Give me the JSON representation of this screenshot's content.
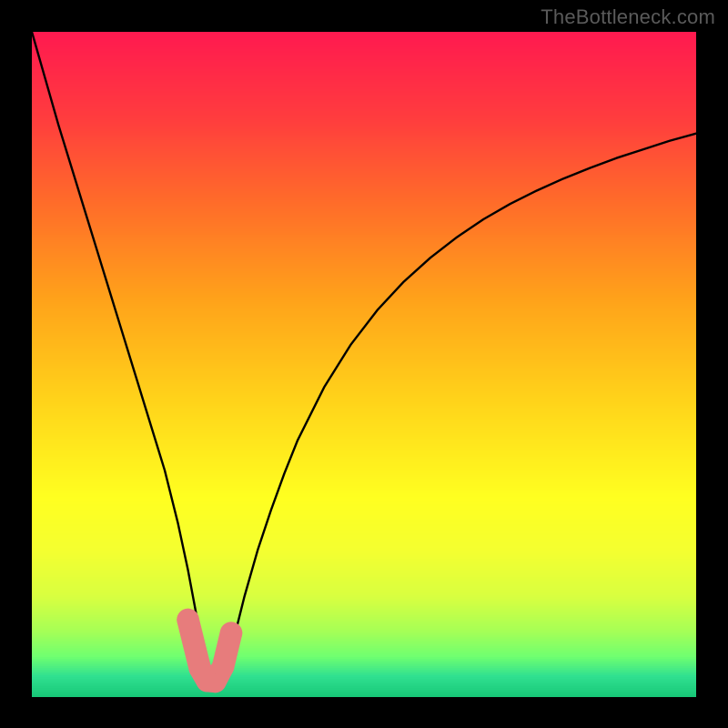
{
  "watermark": "TheBottleneck.com",
  "chart_data": {
    "type": "line",
    "title": "",
    "xlabel": "",
    "ylabel": "",
    "xlim": [
      0,
      100
    ],
    "ylim": [
      0,
      100
    ],
    "grid": false,
    "legend": false,
    "note": "Bottleneck-percentage style curve. Values in percent (0-100). X is normalized horizontal position (0=left,100=right), Y is percent height from bottom (0=green/low,100=red/high). Minimum near x≈27.",
    "series": [
      {
        "name": "bottleneck",
        "x": [
          0,
          2,
          4,
          6,
          8,
          10,
          12,
          14,
          16,
          18,
          20,
          22,
          23.5,
          25,
          26,
          27,
          28,
          29,
          30.5,
          32,
          34,
          36,
          38,
          40,
          44,
          48,
          52,
          56,
          60,
          64,
          68,
          72,
          76,
          80,
          84,
          88,
          92,
          96,
          100
        ],
        "y": [
          100,
          93,
          86,
          79.5,
          73,
          66.5,
          60,
          53.5,
          47,
          40.5,
          34,
          26,
          19,
          11,
          6,
          2.3,
          2,
          4,
          9,
          15,
          22,
          28,
          33.5,
          38.5,
          46.5,
          52.9,
          58.1,
          62.4,
          66,
          69.1,
          71.8,
          74.1,
          76.1,
          77.9,
          79.5,
          81,
          82.3,
          83.6,
          84.7
        ]
      }
    ],
    "markers": {
      "note": "Salmon dots/arc near the minimum dip",
      "color": "#e77c7c",
      "points_xy": [
        [
          23.5,
          11.5
        ],
        [
          25.3,
          4.2
        ],
        [
          26.4,
          2.3
        ],
        [
          27.6,
          2.2
        ],
        [
          28.8,
          4.5
        ],
        [
          30.0,
          9.5
        ]
      ],
      "radius": 1.6
    },
    "gradient": {
      "note": "Background heat gradient, top→bottom. 'pos' in percent from top; colors approximate.",
      "stops": [
        {
          "pos": 0,
          "color": "#ff1a4f"
        },
        {
          "pos": 12,
          "color": "#ff3a3f"
        },
        {
          "pos": 25,
          "color": "#ff6a2a"
        },
        {
          "pos": 40,
          "color": "#ffa21a"
        },
        {
          "pos": 55,
          "color": "#ffd21a"
        },
        {
          "pos": 70,
          "color": "#ffff20"
        },
        {
          "pos": 78,
          "color": "#f4ff30"
        },
        {
          "pos": 85,
          "color": "#d8ff40"
        },
        {
          "pos": 90,
          "color": "#a8ff55"
        },
        {
          "pos": 94,
          "color": "#70ff70"
        },
        {
          "pos": 97,
          "color": "#30e090"
        },
        {
          "pos": 100,
          "color": "#18c878"
        }
      ]
    }
  }
}
